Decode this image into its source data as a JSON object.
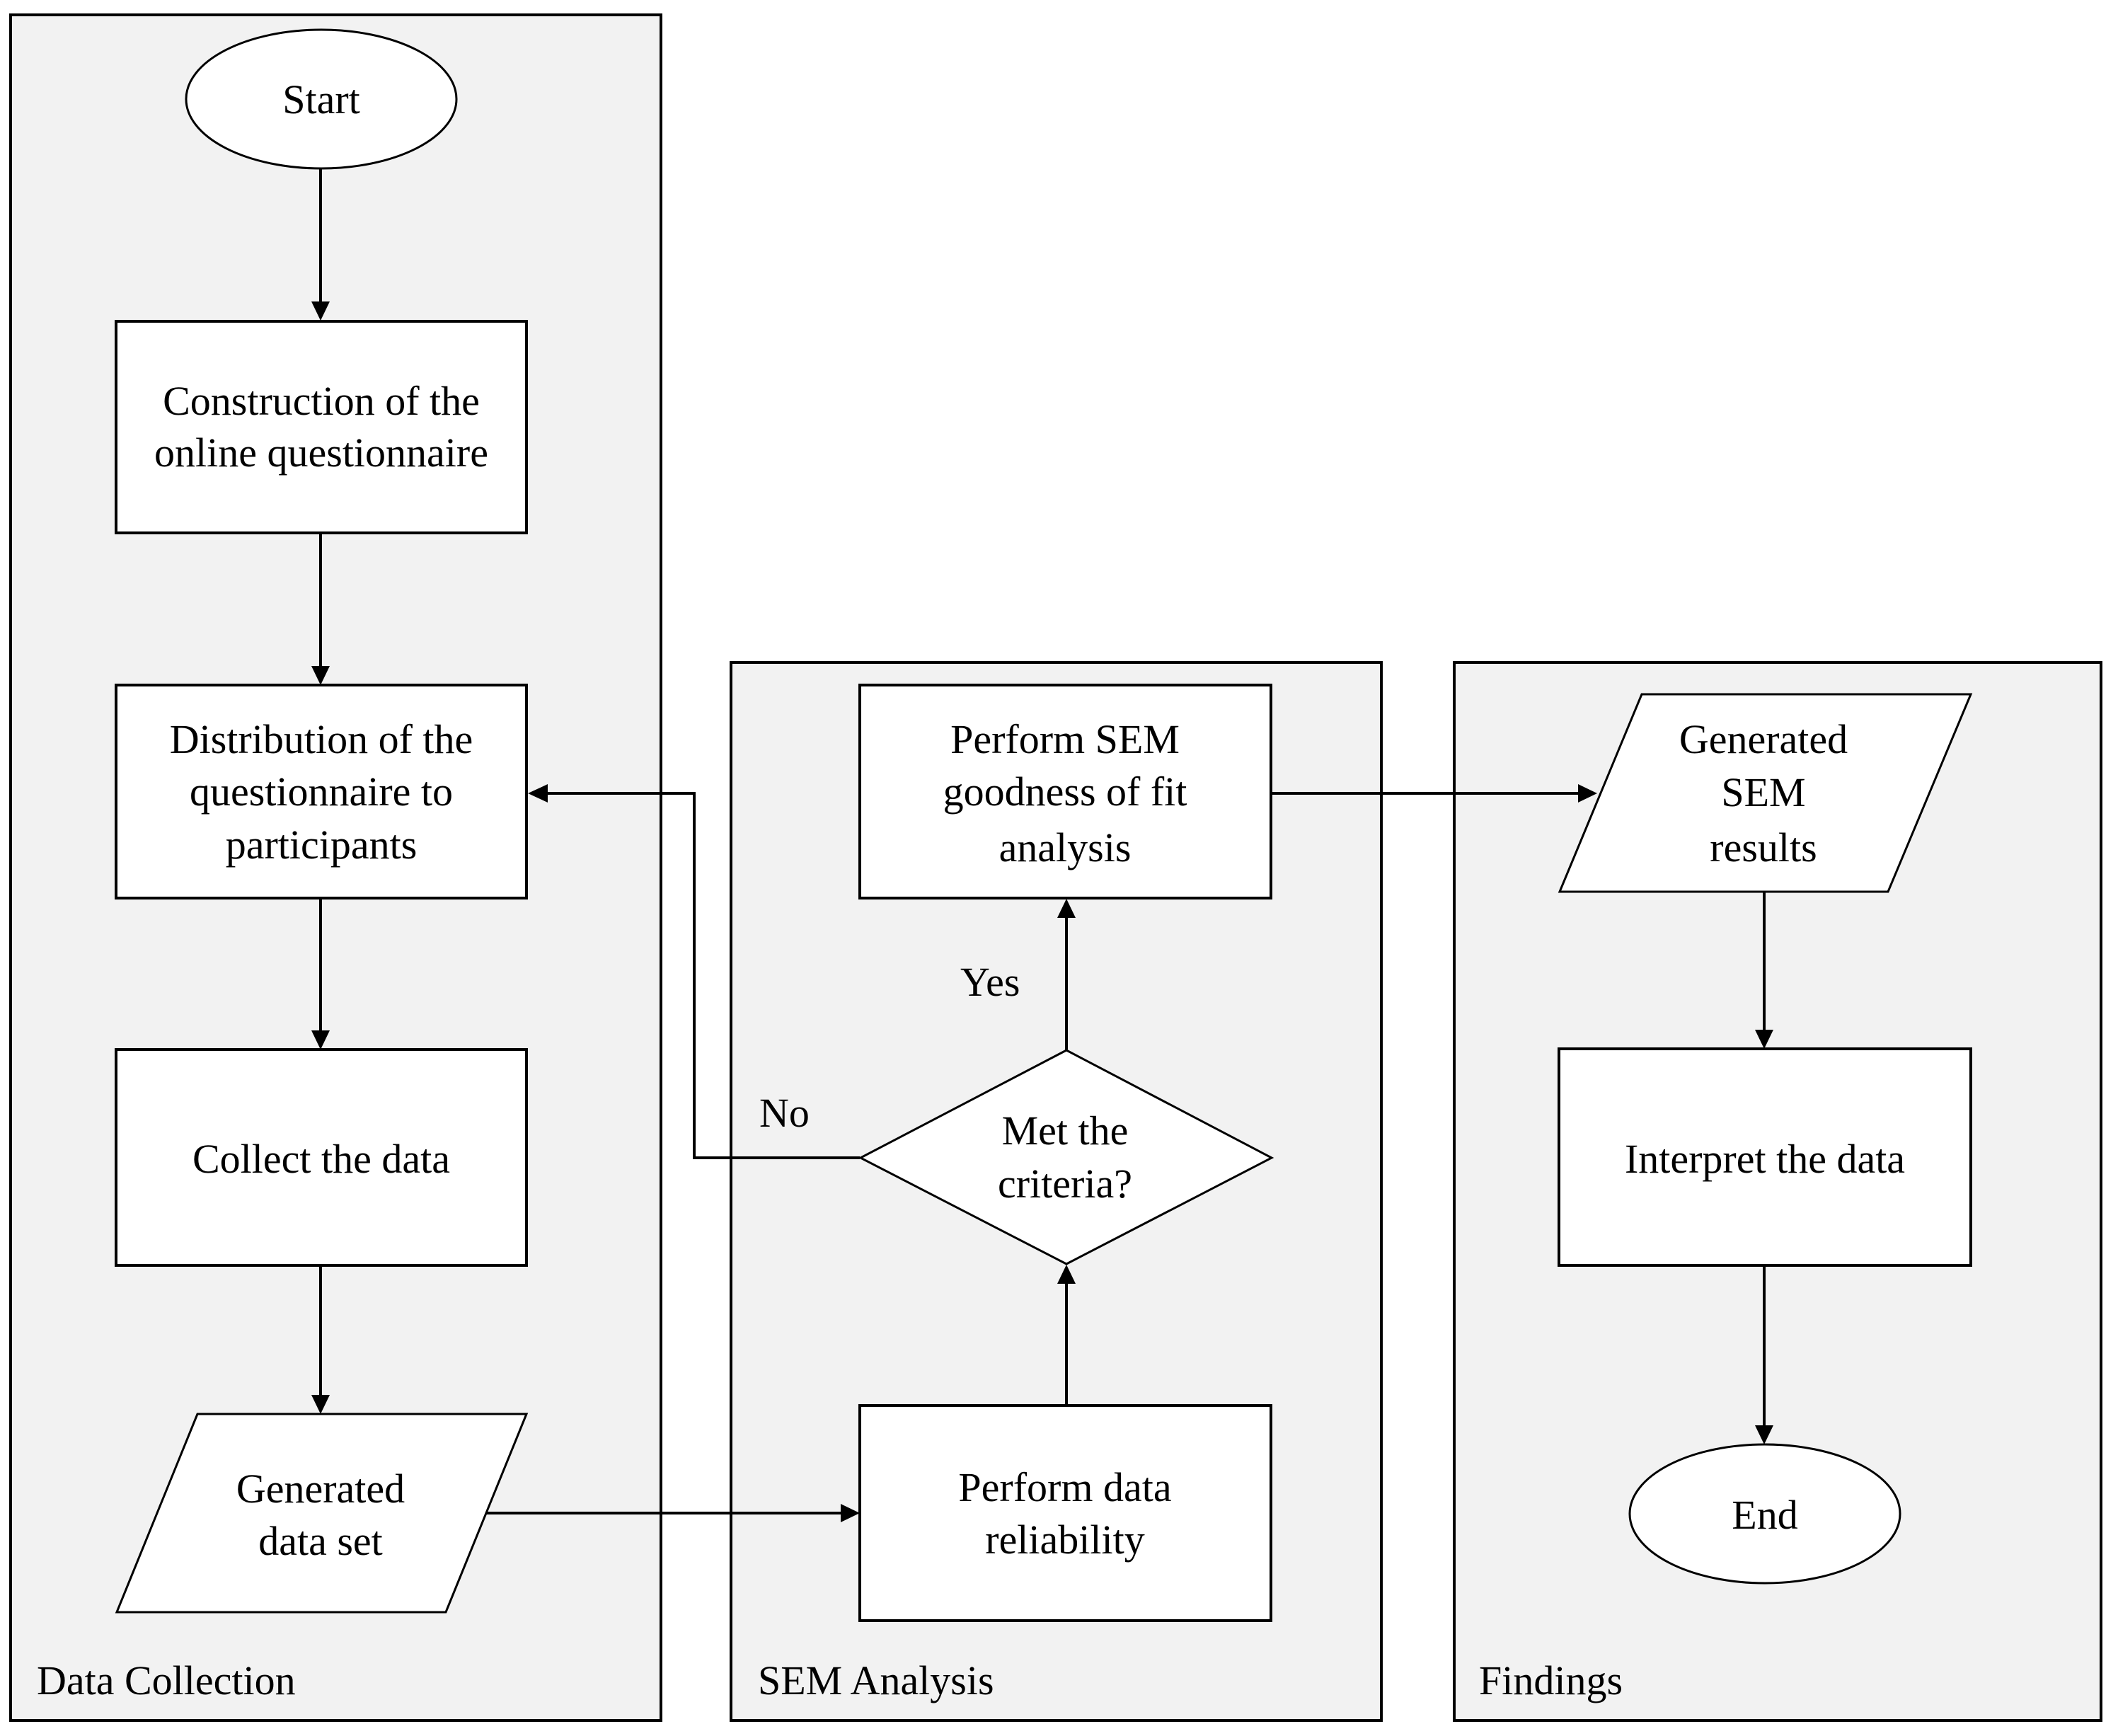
{
  "diagram": {
    "type": "flowchart",
    "background_color": "#ffffff",
    "lane_fill_color": "#f2f2f2",
    "line_color": "#000000",
    "lanes": [
      {
        "id": "data-collection",
        "label": "Data Collection"
      },
      {
        "id": "sem-analysis",
        "label": "SEM Analysis"
      },
      {
        "id": "findings",
        "label": "Findings"
      }
    ],
    "nodes": {
      "start": {
        "shape": "ellipse",
        "lane": "data-collection",
        "lines": [
          "Start"
        ]
      },
      "construct": {
        "shape": "rectangle",
        "lane": "data-collection",
        "lines": [
          "Construction of the",
          "online questionnaire"
        ]
      },
      "distribute": {
        "shape": "rectangle",
        "lane": "data-collection",
        "lines": [
          "Distribution of the",
          "questionnaire to",
          "participants"
        ]
      },
      "collect": {
        "shape": "rectangle",
        "lane": "data-collection",
        "lines": [
          "Collect the data"
        ]
      },
      "dataset": {
        "shape": "parallelogram",
        "lane": "data-collection",
        "lines": [
          "Generated",
          "data set"
        ]
      },
      "reliability": {
        "shape": "rectangle",
        "lane": "sem-analysis",
        "lines": [
          "Perform data",
          "reliability"
        ]
      },
      "criteria": {
        "shape": "diamond",
        "lane": "sem-analysis",
        "lines": [
          "Met the",
          "criteria?"
        ]
      },
      "fit": {
        "shape": "rectangle",
        "lane": "sem-analysis",
        "lines": [
          "Perform SEM",
          "goodness of fit",
          "analysis"
        ]
      },
      "results": {
        "shape": "parallelogram",
        "lane": "findings",
        "lines": [
          "Generated",
          "SEM",
          "results"
        ]
      },
      "interpret": {
        "shape": "rectangle",
        "lane": "findings",
        "lines": [
          "Interpret the data"
        ]
      },
      "end": {
        "shape": "ellipse",
        "lane": "findings",
        "lines": [
          "End"
        ]
      }
    },
    "edges": [
      {
        "from": "start",
        "to": "construct",
        "label": ""
      },
      {
        "from": "construct",
        "to": "distribute",
        "label": ""
      },
      {
        "from": "distribute",
        "to": "collect",
        "label": ""
      },
      {
        "from": "collect",
        "to": "dataset",
        "label": ""
      },
      {
        "from": "dataset",
        "to": "reliability",
        "label": ""
      },
      {
        "from": "reliability",
        "to": "criteria",
        "label": ""
      },
      {
        "from": "criteria",
        "to": "fit",
        "label": "Yes"
      },
      {
        "from": "criteria",
        "to": "distribute",
        "label": "No"
      },
      {
        "from": "fit",
        "to": "results",
        "label": ""
      },
      {
        "from": "results",
        "to": "interpret",
        "label": ""
      },
      {
        "from": "interpret",
        "to": "end",
        "label": ""
      }
    ],
    "edge_labels": {
      "yes": "Yes",
      "no": "No"
    }
  }
}
